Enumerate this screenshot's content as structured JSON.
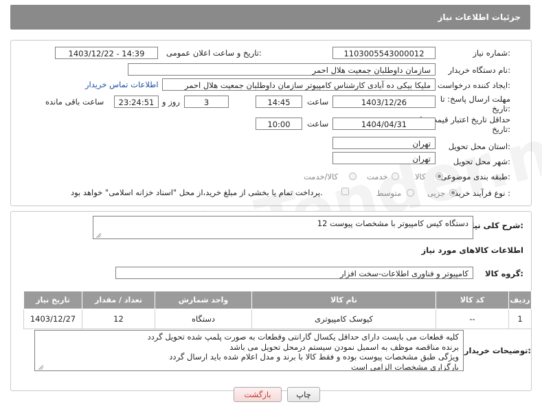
{
  "header": {
    "title": "جزئیات اطلاعات نیاز"
  },
  "form": {
    "need_number_label": "شماره نیاز:",
    "need_number": "1103005543000012",
    "announce_label": "تاریخ و ساعت اعلان عمومی:",
    "announce_value": "1403/12/22 - 14:39",
    "buyer_org_label": "نام دستگاه خریدار:",
    "buyer_org": "سازمان داوطلبان جمعیت هلال احمر",
    "creator_label": "ایجاد کننده درخواست:",
    "creator": "ملیکا بیکی ده آبادی کارشناس کامپیوتر سازمان داوطلبان جمعیت هلال احمر",
    "contact_link": "اطلاعات تماس خریدار",
    "reply_label_1": "مهلت ارسال پاسخ: تا",
    "reply_label_2": "تاریخ:",
    "reply_date": "1403/12/26",
    "time_word": "ساعت",
    "reply_time": "14:45",
    "days": "3",
    "days_word": "روز و",
    "remaining": "23:24:51",
    "remaining_word": "ساعت باقی مانده",
    "validity_label_1": "حداقل تاریخ اعتبار قیمت: تا",
    "validity_label_2": "تاریخ:",
    "validity_date": "1404/04/31",
    "validity_time": "10:00",
    "province_label": "استان محل تحویل:",
    "province": "تهران",
    "city_label": "شهر محل تحویل:",
    "city": "تهران",
    "category_label": "طبقه بندی موضوعی:",
    "category_options": [
      "کالا",
      "خدمت",
      "کالا/خدمت"
    ],
    "process_label": "نوع فرآیند خرید :",
    "process_options": [
      "جزیی",
      "متوسط"
    ],
    "payment_note": "پرداخت تمام یا بخشی از مبلغ خرید،از محل \"اسناد خزانه اسلامی\" خواهد بود."
  },
  "summary": {
    "label": "شرح کلی نیاز:",
    "value": "12 دستگاه کیس کامپیوتر با مشخصات پیوست",
    "goods_info_title": "اطلاعات کالاهای مورد نیاز",
    "goods_group_label": "گروه کالا:",
    "goods_group": "کامپیوتر و فناوری اطلاعات-سخت افزار"
  },
  "table": {
    "headers": [
      "ردیف",
      "کد کالا",
      "نام کالا",
      "واحد شمارش",
      "تعداد / مقدار",
      "تاریخ نیاز"
    ],
    "rows": [
      [
        "1",
        "--",
        "کیوسک کامپیوتری",
        "دستگاه",
        "12",
        "1403/12/27"
      ]
    ]
  },
  "notes": {
    "label": "توضیحات خریدار:",
    "lines": [
      "کلیه قطعات می بایست دارای حداقل یکسال گارانتی وقطعات به صورت پلمپ شده تحویل گردد",
      "برنده مناقصه موظف به اسمبل نمودن سیستم درمحل تحویل می باشد",
      "ویژگی طبق مشخصات پیوست بوده و فقط کالا با برند و مدل اعلام شده باید ارسال گردد",
      "بارگزاری مشخصات الزامی است"
    ]
  },
  "buttons": {
    "print": "چاپ",
    "back": "بازگشت"
  },
  "watermark": "AriaTender.neT"
}
